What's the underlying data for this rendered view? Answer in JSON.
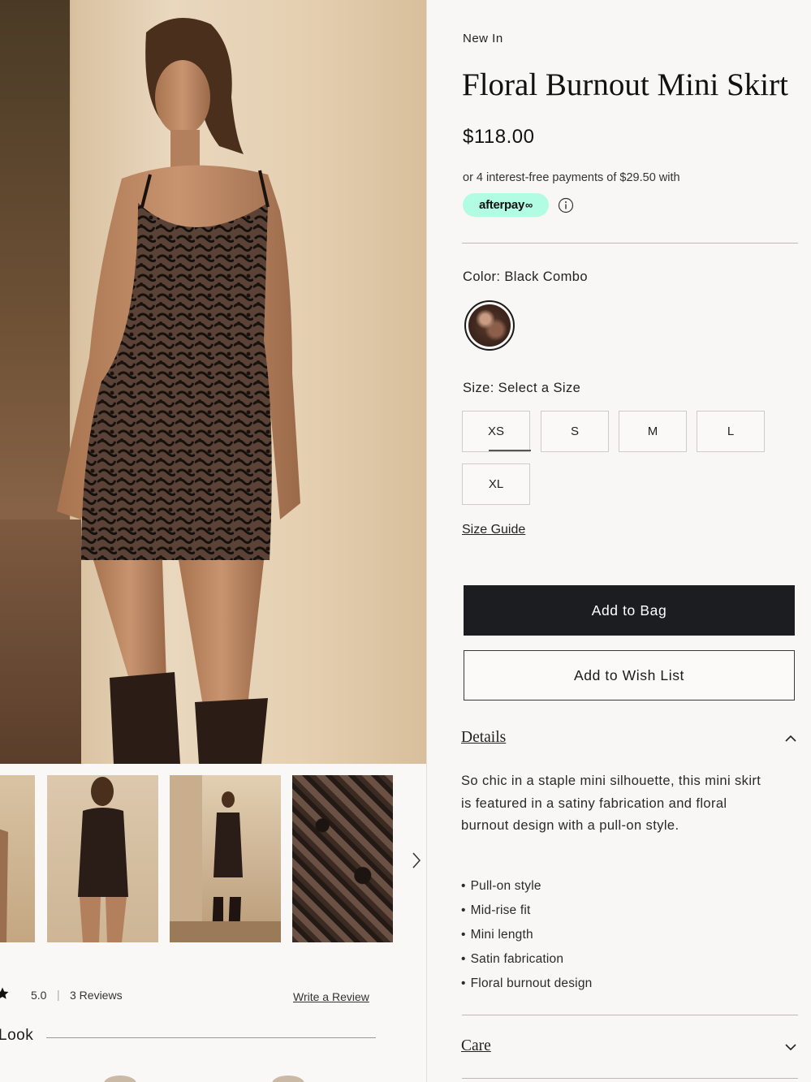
{
  "product": {
    "eyebrow": "New In",
    "title": "Floral Burnout Mini Skirt",
    "price": "$118.00",
    "installments_text": "or 4 interest-free payments of $29.50 with",
    "afterpay_label": "afterpay",
    "afterpay_mark": "∞",
    "color_label": "Color: Black Combo",
    "size_label": "Size: Select a Size",
    "sizes": [
      "XS",
      "S",
      "M",
      "L",
      "XL"
    ],
    "size_guide": "Size Guide",
    "add_to_bag": "Add to Bag",
    "add_to_wishlist": "Add to Wish List"
  },
  "details": {
    "heading": "Details",
    "description": "So chic in a staple mini silhouette, this mini skirt is featured in a satiny fabrication and floral burnout design with a pull-on style.",
    "bullets": [
      "Pull-on style",
      "Mid-rise fit",
      "Mini length",
      "Satin fabrication",
      "Floral burnout design"
    ]
  },
  "care": {
    "heading": "Care"
  },
  "reviews": {
    "score": "5.0",
    "separator": "|",
    "count_label": "3 Reviews",
    "write_review": "Write a Review"
  },
  "look": {
    "label": "Look"
  },
  "icons": {
    "next": "chevron-right-icon",
    "info": "info-icon",
    "expand": "chevron-down-icon",
    "star": "star-icon"
  },
  "colors": {
    "primary_button": "#1b1d21",
    "afterpay_mint": "#b2fce4"
  }
}
